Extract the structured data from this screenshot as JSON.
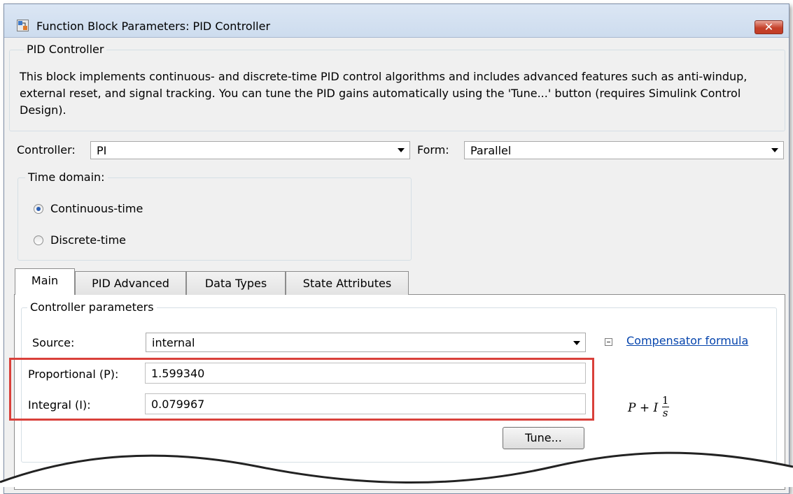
{
  "window": {
    "title": "Function Block Parameters: PID Controller",
    "close_glyph": "✕"
  },
  "block_group": {
    "label": "PID Controller",
    "description": "This block implements continuous- and discrete-time PID control algorithms and includes advanced features such as anti-windup, external reset, and signal tracking. You can tune the PID gains automatically using the 'Tune...' button (requires Simulink Control Design)."
  },
  "controller": {
    "label": "Controller:",
    "value": "PI"
  },
  "form": {
    "label": "Form:",
    "value": "Parallel"
  },
  "time_domain": {
    "label": "Time domain:",
    "options": [
      {
        "label": "Continuous-time",
        "selected": true
      },
      {
        "label": "Discrete-time",
        "selected": false
      }
    ]
  },
  "tabs": [
    {
      "label": "Main",
      "active": true
    },
    {
      "label": "PID Advanced",
      "active": false
    },
    {
      "label": "Data Types",
      "active": false
    },
    {
      "label": "State Attributes",
      "active": false
    }
  ],
  "params": {
    "group_label": "Controller parameters",
    "source_label": "Source:",
    "source_value": "internal",
    "compensator_link": "Compensator formula",
    "proportional_label": "Proportional (P):",
    "proportional_value": "1.599340",
    "integral_label": "Integral (I):",
    "integral_value": "0.079967",
    "tune_label": "Tune...",
    "formula": {
      "main": "P + I",
      "numerator": "1",
      "denominator": "s"
    }
  },
  "colors": {
    "highlight": "#d9403a",
    "link": "#0645ad",
    "radio_accent": "#2b5fb3",
    "close_button": "#c5412b"
  }
}
